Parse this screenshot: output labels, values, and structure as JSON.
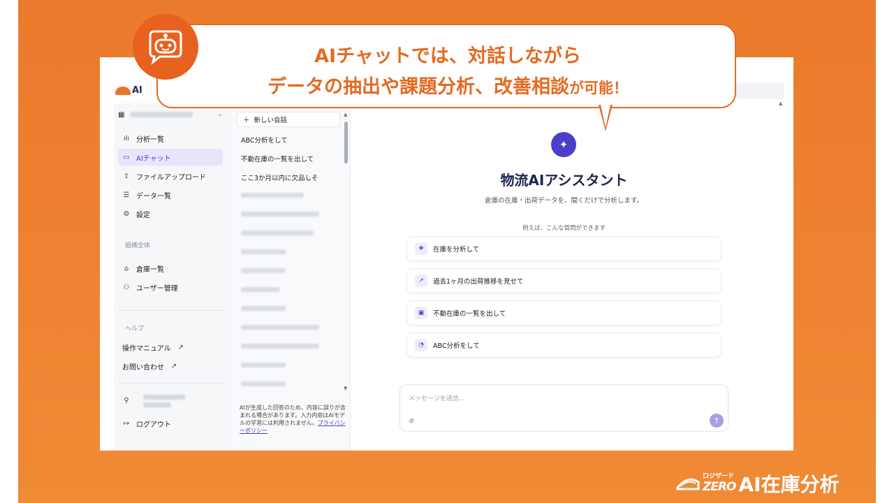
{
  "callout": {
    "line1": "AIチャットでは、対話しながら",
    "line2": "データの抽出や課題分析、改善相談",
    "line2_small": "が可能！"
  },
  "app": {
    "logo_text": "AI"
  },
  "sidebar": {
    "items": [
      {
        "label": "分析一覧",
        "icon": "bar-chart-icon"
      },
      {
        "label": "AIチャット",
        "icon": "chat-icon"
      },
      {
        "label": "ファイルアップロード",
        "icon": "upload-icon"
      },
      {
        "label": "データ一覧",
        "icon": "database-icon"
      },
      {
        "label": "設定",
        "icon": "gear-icon"
      }
    ],
    "org_section_label": "組織全体",
    "org_items": [
      {
        "label": "倉庫一覧",
        "icon": "warehouse-icon"
      },
      {
        "label": "ユーザー管理",
        "icon": "users-icon"
      }
    ],
    "help_label": "ヘルプ",
    "help_items": [
      {
        "label": "操作マニュアル",
        "icon": "external-link-icon"
      },
      {
        "label": "お問い合わせ",
        "icon": "external-link-icon"
      }
    ],
    "logout_label": "ログアウト"
  },
  "history": {
    "new_chat_label": "新しい会話",
    "items": [
      "ABC分析をして",
      "不動在庫の一覧を出して",
      "ここ3か月以内に欠品しそ"
    ],
    "disclaimer": "AIが生成した回答のため、内容に誤りが含まれる場合があります。入力内容はAIモデルの学習には利用されません。",
    "privacy_link": "プライバシーポリシー"
  },
  "main": {
    "title": "物流AIアシスタント",
    "subtitle": "倉庫の在庫・出荷データを、聞くだけで分析します。",
    "examples_label": "例えば、こんな質問ができます",
    "suggestions": [
      {
        "label": "在庫を分析して",
        "icon": "cubes-icon"
      },
      {
        "label": "過去1ヶ月の出荷推移を見せて",
        "icon": "trend-icon"
      },
      {
        "label": "不動在庫の一覧を出して",
        "icon": "box-icon"
      },
      {
        "label": "ABC分析をして",
        "icon": "pie-icon"
      }
    ],
    "composer_placeholder": "メッセージを送信..."
  },
  "brand": {
    "small": "ロジザード",
    "zero": "ZERO",
    "name": "AI在庫分析"
  },
  "colors": {
    "accent_orange": "#e46a22",
    "accent_purple": "#4b3fc7"
  }
}
